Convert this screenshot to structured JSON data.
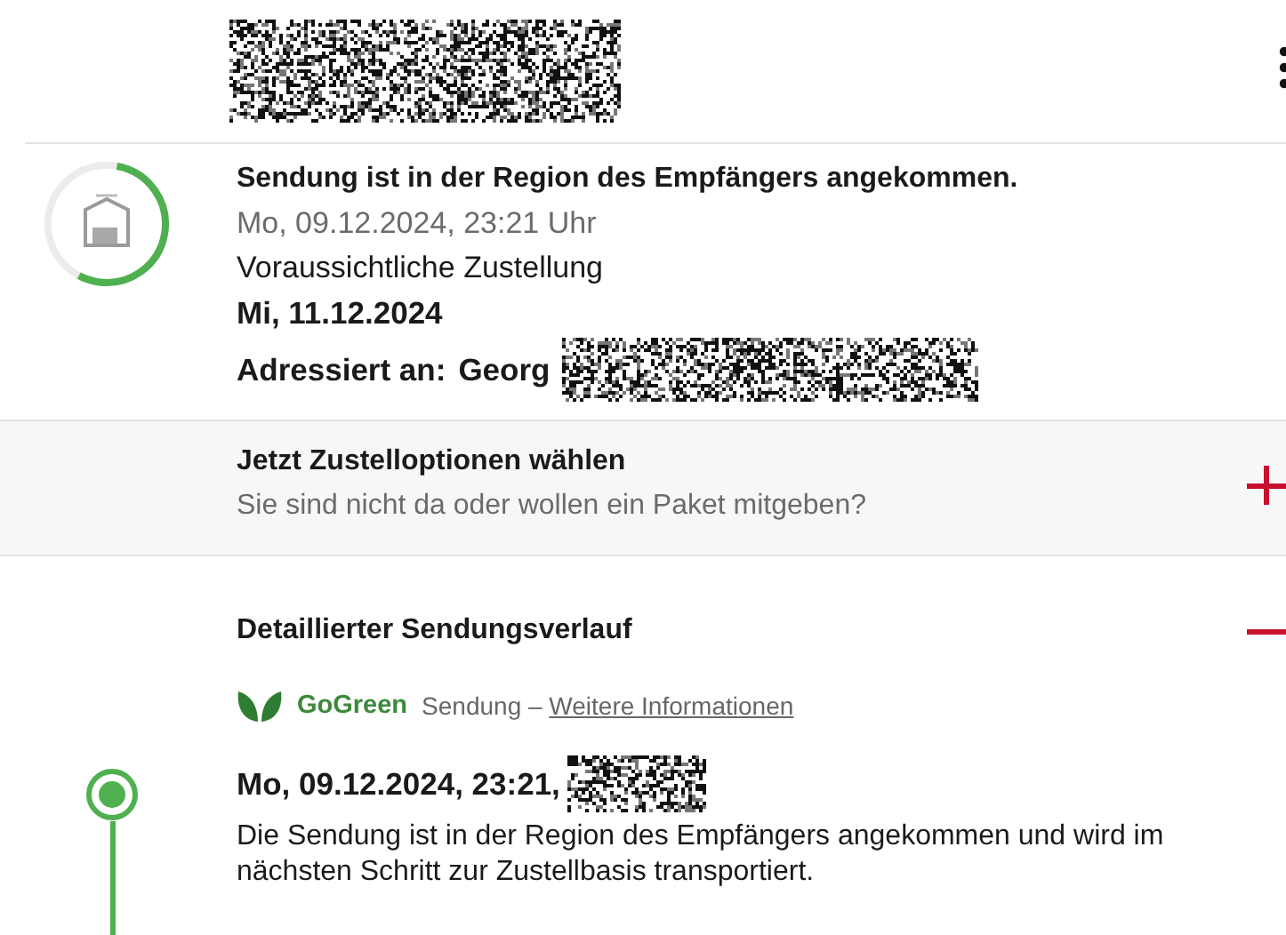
{
  "status": {
    "title": "Sendung ist in der Region des Empfängers angekommen.",
    "timestamp": "Mo, 09.12.2024, 23:21 Uhr",
    "delivery_label": "Voraussichtliche Zustellung",
    "delivery_date": "Mi, 11.12.2024",
    "addressed_label": "Adressiert an:",
    "addressee": "Georg"
  },
  "delivery_options": {
    "title": "Jetzt Zustelloptionen wählen",
    "subtitle": "Sie sind nicht da oder wollen ein Paket mitgeben?",
    "expanded": false
  },
  "history": {
    "title": "Detaillierter Sendungsverlauf",
    "expanded": true,
    "gogreen": {
      "brand": "GoGreen",
      "text": "Sendung –",
      "link": "Weitere Informationen"
    },
    "events": [
      {
        "date": "Mo, 09.12.2024, 23:21,",
        "description": "Die Sendung ist in der Region des Empfängers angekommen und wird im nächsten Schritt zur Zustellbasis transportiert.",
        "selected": true
      }
    ]
  }
}
